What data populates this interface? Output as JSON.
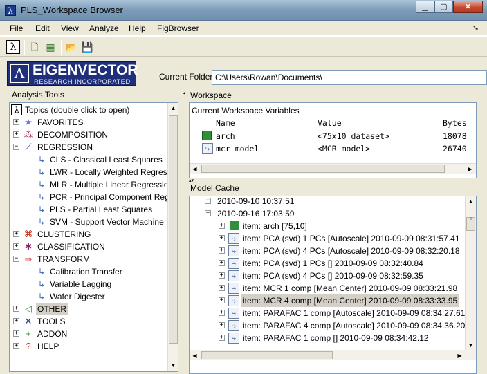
{
  "window": {
    "title": "PLS_Workspace Browser"
  },
  "menu": [
    "File",
    "Edit",
    "View",
    "Analyze",
    "Help",
    "FigBrowser"
  ],
  "toolbar": {
    "lambda": "λ"
  },
  "logo": {
    "line1": "EIGENVECTOR",
    "line2": "RESEARCH INCORPORATED"
  },
  "current_folder": {
    "label": "Current Folder :",
    "value": "C:\\Users\\Rowan\\Documents\\"
  },
  "analysis_tools": {
    "header": "Analysis Tools",
    "root": "Topics (double click to open)",
    "items": [
      {
        "label": "FAVORITES",
        "type": "folder",
        "icon": "star-icon"
      },
      {
        "label": "DECOMPOSITION",
        "type": "folder",
        "icon": "decomposition-icon"
      },
      {
        "label": "REGRESSION",
        "type": "folder-open",
        "icon": "regression-icon"
      },
      {
        "label": "CLS - Classical Least Squares",
        "type": "leaf"
      },
      {
        "label": "LWR - Locally Weighted Regress",
        "type": "leaf"
      },
      {
        "label": "MLR - Multiple Linear Regressio",
        "type": "leaf"
      },
      {
        "label": "PCR - Principal Component Reg",
        "type": "leaf"
      },
      {
        "label": "PLS - Partial Least Squares",
        "type": "leaf"
      },
      {
        "label": "SVM - Support Vector Machine",
        "type": "leaf"
      },
      {
        "label": "CLUSTERING",
        "type": "folder",
        "icon": "clustering-icon"
      },
      {
        "label": "CLASSIFICATION",
        "type": "folder",
        "icon": "classification-icon"
      },
      {
        "label": "TRANSFORM",
        "type": "folder-open",
        "icon": "transform-icon"
      },
      {
        "label": "Calibration Transfer",
        "type": "leaf"
      },
      {
        "label": "Variable Lagging",
        "type": "leaf"
      },
      {
        "label": "Wafer Digester",
        "type": "leaf"
      },
      {
        "label": "OTHER",
        "type": "folder",
        "icon": "share-icon"
      },
      {
        "label": "TOOLS",
        "type": "folder",
        "icon": "tools-icon"
      },
      {
        "label": "ADDON",
        "type": "folder",
        "icon": "addon-icon"
      },
      {
        "label": "HELP",
        "type": "folder",
        "icon": "help-icon"
      }
    ]
  },
  "workspace": {
    "header": "Workspace",
    "sub": "Current Workspace Variables",
    "columns": [
      "Name",
      "Value",
      "Bytes"
    ],
    "rows": [
      {
        "name": "arch",
        "value": "<75x10 dataset>",
        "bytes": "18078",
        "icon": "dataset-icon"
      },
      {
        "name": "mcr_model",
        "value": "<MCR model>",
        "bytes": "26740",
        "icon": "model-icon"
      }
    ]
  },
  "model_cache": {
    "header": "Model Cache",
    "items": [
      {
        "label": "2010-09-10 10:37:51",
        "level": 0,
        "kind": "date"
      },
      {
        "label": "2010-09-16 17:03:59",
        "level": 0,
        "kind": "date-open"
      },
      {
        "label": "item: arch [75,10]",
        "level": 1,
        "kind": "dataset"
      },
      {
        "label": "item: PCA (svd) 1 PCs [Autoscale]  2010-09-09 08:31:57.41",
        "level": 1,
        "kind": "model"
      },
      {
        "label": "item: PCA (svd) 4 PCs [Autoscale]  2010-09-09 08:32:20.18",
        "level": 1,
        "kind": "model"
      },
      {
        "label": "item: PCA (svd) 1 PCs []  2010-09-09 08:32:40.84",
        "level": 1,
        "kind": "model"
      },
      {
        "label": "item: PCA (svd) 4 PCs []  2010-09-09 08:32:59.35",
        "level": 1,
        "kind": "model"
      },
      {
        "label": "item: MCR 1 comp [Mean Center]  2010-09-09 08:33:21.98",
        "level": 1,
        "kind": "model"
      },
      {
        "label": "item: MCR 4 comp [Mean Center]  2010-09-09 08:33:33.95",
        "level": 1,
        "kind": "model",
        "selected": true
      },
      {
        "label": "item: PARAFAC 1 comp [Autoscale]  2010-09-09 08:34:27.61",
        "level": 1,
        "kind": "model"
      },
      {
        "label": "item: PARAFAC 4 comp [Autoscale]  2010-09-09 08:34:36.20",
        "level": 1,
        "kind": "model"
      },
      {
        "label": "item: PARAFAC 1 comp []  2010-09-09 08:34:42.12",
        "level": 1,
        "kind": "model"
      }
    ]
  }
}
